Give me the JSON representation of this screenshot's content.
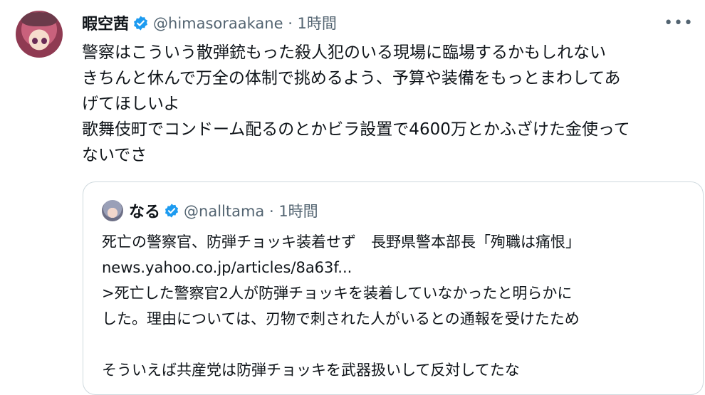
{
  "tweet": {
    "display_name": "暇空茜",
    "handle_time": "@himasoraakane · 1時間",
    "verified_icon": "verified-badge-icon",
    "more_icon": "more-dots-icon",
    "lines": [
      "警察はこういう散弾銃もった殺人犯のいる現場に臨場するかもしれない",
      "きちんと休んで万全の体制で挑めるよう、予算や装備をもっとまわしてあ",
      "げてほしいよ",
      "歌舞伎町でコンドーム配るのとかビラ設置で4600万とかふざけた金使って",
      "ないでさ"
    ]
  },
  "quote": {
    "display_name": "なる",
    "handle_time": "@nalltama · 1時間",
    "lines": [
      "死亡の警察官、防弾チョッキ装着せず　長野県警本部長「殉職は痛恨」",
      "news.yahoo.co.jp/articles/8a63f...",
      ">死亡した警察官2人が防弾チョッキを装着していなかったと明らかに",
      "した。理由については、刃物で刺された人がいるとの通報を受けたため",
      "",
      "そういえば共産党は防弾チョッキを武器扱いして反対してたな"
    ]
  },
  "colors": {
    "verified": "#1d9bf0",
    "secondary_text": "#536471",
    "border": "#cfd9de"
  }
}
